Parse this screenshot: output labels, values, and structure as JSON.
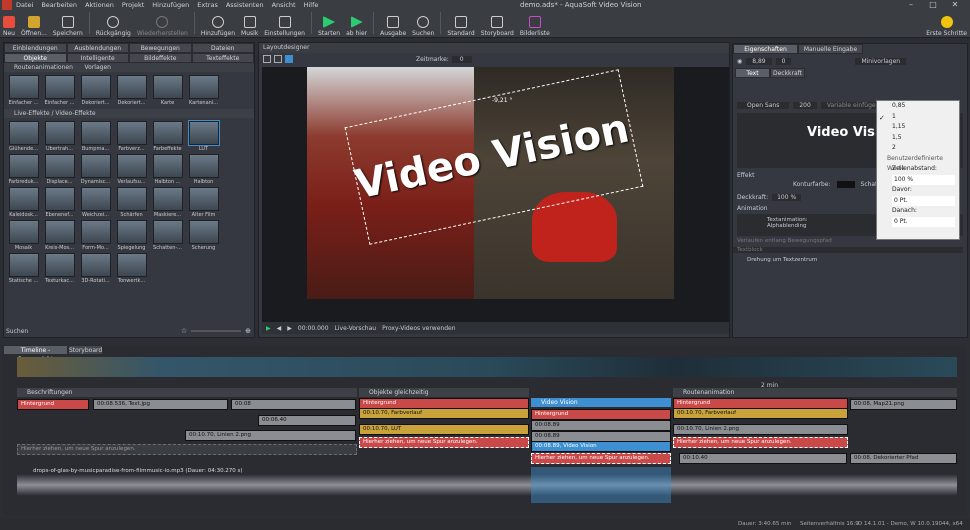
{
  "app": {
    "title": "demo.ads* - AquaSoft Video Vision"
  },
  "menu": [
    "Datei",
    "Bearbeiten",
    "Aktionen",
    "Projekt",
    "Hinzufügen",
    "Extras",
    "Assistenten",
    "Ansicht",
    "Hilfe"
  ],
  "toolbar": [
    "Neu",
    "Öffnen...",
    "Speichern",
    "Rückgängig",
    "Wiederherstellen",
    "Hinzufügen",
    "Musik",
    "Einstellungen",
    "Starten",
    "ab hier",
    "Ausgabe",
    "Suchen",
    "Standard",
    "Storyboard",
    "Bilderliste"
  ],
  "toolbar_right": "Erste Schritte",
  "left": {
    "tabs_top": [
      "Einblendungen",
      "Ausblendungen",
      "Bewegungen",
      "Dateien"
    ],
    "tabs": [
      "Objekte",
      "Intelligente Vorlagen",
      "Bildeffekte",
      "Texteffekte"
    ],
    "sec1": "Routenanimationen",
    "routes": [
      "Einfacher ...",
      "Einfacher ...",
      "Dekoriert...",
      "Dekoriert...",
      "Karte",
      "Kartenani..."
    ],
    "sec2": "Live-Effekte / Video-Effekte",
    "effects": [
      "Glühende...",
      "Übertrah...",
      "Bumpma...",
      "Farbverz...",
      "Farbeffekte",
      "LUT",
      "Farbreduk...",
      "Displace...",
      "Dynamisc...",
      "Verlaufsu...",
      "Halbton ...",
      "Halbton",
      "Kaleidosk...",
      "Ebenenef...",
      "Weichzei...",
      "Schärfen",
      "Maskiere...",
      "Alter Film",
      "Mosaik",
      "Kreis-Mos...",
      "Form-Mo...",
      "Spiegelung",
      "Schatten-...",
      "Scherung",
      "Statische ...",
      "Texturkac...",
      "3D-Rotati...",
      "Tonwertk..."
    ],
    "search_label": "Suchen"
  },
  "layout": {
    "title": "Layoutdesigner",
    "zeitmarke_label": "Zeitmarke:",
    "zeitmarke_value": "0",
    "text": "Video Vision",
    "coord": "-9,21 °",
    "time": "00:00.000",
    "live": "Live-Vorschau",
    "proxy": "Proxy-Videos verwenden"
  },
  "props": {
    "tabs": [
      "Eigenschaften",
      "Manuelle Eingabe"
    ],
    "val1": "8,89",
    "val2": "0",
    "mode": "Minivorlagen",
    "subtabs": [
      "Text",
      "Deckkraft"
    ],
    "font": "Open Sans",
    "size": "200",
    "var": "Variable einfügen",
    "preview": "Video Visio",
    "effekt": "Effekt",
    "konturfarbe": "Konturfarbe:",
    "schatten": "Schattenfar",
    "deckkraft_label": "Deckkraft:",
    "deckkraft_val": "100 %",
    "animation": "Animation",
    "textanim": "Textanimation:",
    "textanim_val": "Alphablending",
    "verlauf": "Verlaufen entlang Bewegungspfad",
    "textblock": "Textblock",
    "drehung": "Drehung um Textzentrum"
  },
  "dropdown": {
    "items": [
      "0,85",
      "1",
      "1,15",
      "1,5",
      "2"
    ],
    "custom": "Benutzerdefinierte Werte",
    "zeilen": "Zeilenabstand:",
    "zeilen_val": "100 %",
    "davor": "Davor:",
    "davor_val": "0 Pt.",
    "danach": "Danach:",
    "danach_val": "0 Pt."
  },
  "timeline": {
    "tabs": [
      "Timeline - Spuransicht",
      "Storyboard"
    ],
    "ruler": "2 min",
    "headers": [
      "Beschriftungen",
      "Objekte gleichzeitig",
      "Video Vision",
      "Routenanimation"
    ],
    "clips": [
      "Hintergrund",
      "00:08.536, Text.jpg",
      "00:08",
      "00:06.40",
      "00:10.70, Linien 2.png",
      "Hintergrund",
      "00:10.70, Farbverlauf",
      "00:10.70, LUT",
      "Hierher ziehen, um neue Spur anzulegen.",
      "Hintergrund",
      "00:08.89",
      "00:08.89",
      "00:08.89, Video Vision",
      "Hierher ziehen, um neue Spur anzulegen.",
      "Hintergrund",
      "00:10.70, Farbverlauf",
      "00:10.70, Linien 2.png",
      "Hierher ziehen, um neue Spur anzulegen.",
      "00:10.40",
      "00:08, Map21.png",
      "00:08, Dekorierter Pfad",
      "Hierher ziehen, um neue Spur anzulegen."
    ],
    "audio": "drops-of-glas-by-musicparadise-from-filmmusic-io.mp3 (Dauer: 04:30.270 s)"
  },
  "status": {
    "dauer": "Dauer: 3:40.65 min",
    "seiten": "Seitenverhältnis 16:9",
    "version": "D 14.1.01 - Demo, W 10.0.19044, x64"
  }
}
